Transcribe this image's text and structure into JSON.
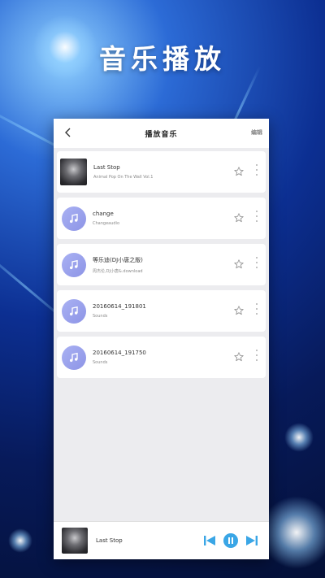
{
  "banner": {
    "title": "音乐播放"
  },
  "screen": {
    "title": "播放音乐",
    "edit_label": "编辑",
    "songs": [
      {
        "title": "Last Stop",
        "subtitle": "Animal Pop On The Wall Vol.1",
        "thumb": "album-art"
      },
      {
        "title": "change",
        "subtitle": "Changeaudio",
        "thumb": "music-note"
      },
      {
        "title": "等乐迪(DJ小唐之版)",
        "subtitle": "周杰伦,DJ小唐&.download",
        "thumb": "music-note"
      },
      {
        "title": "20160614_191801",
        "subtitle": "Sounds",
        "thumb": "music-note"
      },
      {
        "title": "20160614_191750",
        "subtitle": "Sounds",
        "thumb": "music-note"
      }
    ]
  },
  "player": {
    "title": "Last Stop"
  },
  "colors": {
    "accent": "#3aa6e6",
    "note_icon": "#9aa1ee",
    "page_bg": "#ececef"
  }
}
